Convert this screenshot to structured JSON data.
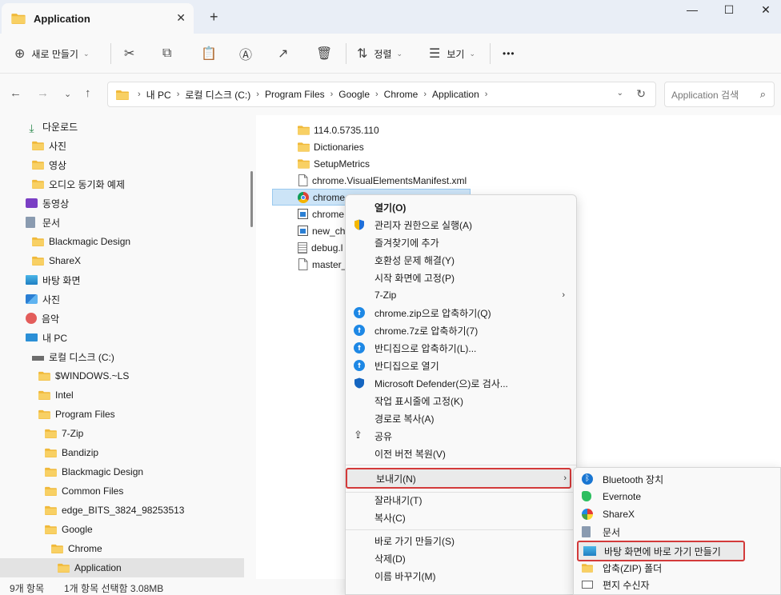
{
  "tab": {
    "title": "Application",
    "close": "✕",
    "new": "+"
  },
  "window": {
    "minimize": "—",
    "maximize": "☐",
    "close": "✕"
  },
  "toolbar": {
    "new_label": "새로 만들기",
    "sort_label": "정렬",
    "view_label": "보기",
    "more": "•••"
  },
  "address": {
    "crumbs": [
      "내 PC",
      "로컬 디스크 (C:)",
      "Program Files",
      "Google",
      "Chrome",
      "Application"
    ],
    "search_placeholder": "Application 검색"
  },
  "sidebar": {
    "items": [
      {
        "label": "다운로드",
        "icon": "download-icon"
      },
      {
        "label": "사진",
        "icon": "folder-icon"
      },
      {
        "label": "영상",
        "icon": "folder-icon"
      },
      {
        "label": "오디오 동기화 예제",
        "icon": "folder-icon"
      },
      {
        "label": "동영상",
        "icon": "video-icon"
      },
      {
        "label": "문서",
        "icon": "document-icon"
      },
      {
        "label": "Blackmagic Design",
        "icon": "folder-icon"
      },
      {
        "label": "ShareX",
        "icon": "folder-icon"
      },
      {
        "label": "바탕 화면",
        "icon": "desktop-icon"
      },
      {
        "label": "사진",
        "icon": "pictures-icon"
      },
      {
        "label": "음악",
        "icon": "music-icon"
      },
      {
        "label": "내 PC",
        "icon": "pc-icon"
      },
      {
        "label": "로컬 디스크 (C:)",
        "icon": "drive-icon"
      },
      {
        "label": "$WINDOWS.~LS",
        "icon": "folder-icon"
      },
      {
        "label": "Intel",
        "icon": "folder-icon"
      },
      {
        "label": "Program Files",
        "icon": "folder-icon"
      },
      {
        "label": "7-Zip",
        "icon": "folder-icon"
      },
      {
        "label": "Bandizip",
        "icon": "folder-icon"
      },
      {
        "label": "Blackmagic Design",
        "icon": "folder-icon"
      },
      {
        "label": "Common Files",
        "icon": "folder-icon"
      },
      {
        "label": "edge_BITS_3824_98253513",
        "icon": "folder-icon"
      },
      {
        "label": "Google",
        "icon": "folder-icon"
      },
      {
        "label": "Chrome",
        "icon": "folder-icon"
      },
      {
        "label": "Application",
        "icon": "folder-icon"
      }
    ]
  },
  "files": [
    {
      "name": "114.0.5735.110",
      "icon": "folder-icon"
    },
    {
      "name": "Dictionaries",
      "icon": "folder-icon"
    },
    {
      "name": "SetupMetrics",
      "icon": "folder-icon"
    },
    {
      "name": "chrome.VisualElementsManifest.xml",
      "icon": "file-icon"
    },
    {
      "name": "chrome",
      "icon": "chrome-icon"
    },
    {
      "name": "chrome",
      "icon": "app-icon"
    },
    {
      "name": "new_ch",
      "icon": "app-icon"
    },
    {
      "name": "debug.l",
      "icon": "log-icon"
    },
    {
      "name": "master_",
      "icon": "file-icon"
    }
  ],
  "context_menu": {
    "items": [
      {
        "label": "열기(O)",
        "icon": ""
      },
      {
        "label": "관리자 권한으로 실행(A)",
        "icon": "shield-icon"
      },
      {
        "label": "즐겨찾기에 추가",
        "icon": ""
      },
      {
        "label": "호환성 문제 해결(Y)",
        "icon": ""
      },
      {
        "label": "시작 화면에 고정(P)",
        "icon": ""
      },
      {
        "label": "7-Zip",
        "icon": ""
      },
      {
        "label": "chrome.zip으로 압축하기(Q)",
        "icon": "bandizip-icon"
      },
      {
        "label": "chrome.7z로 압축하기(7)",
        "icon": "bandizip-icon"
      },
      {
        "label": "반디집으로 압축하기(L)...",
        "icon": "bandizip-icon"
      },
      {
        "label": "반디집으로 열기",
        "icon": "bandizip-icon"
      },
      {
        "label": "Microsoft Defender(으)로 검사...",
        "icon": "defender-icon"
      },
      {
        "label": "작업 표시줄에 고정(K)",
        "icon": ""
      },
      {
        "label": "경로로 복사(A)",
        "icon": ""
      },
      {
        "label": "공유",
        "icon": "share-icon"
      },
      {
        "label": "이전 버전 복원(V)",
        "icon": ""
      },
      {
        "label": "보내기(N)",
        "icon": ""
      },
      {
        "label": "잘라내기(T)",
        "icon": ""
      },
      {
        "label": "복사(C)",
        "icon": ""
      },
      {
        "label": "바로 가기 만들기(S)",
        "icon": ""
      },
      {
        "label": "삭제(D)",
        "icon": ""
      },
      {
        "label": "이름 바꾸기(M)",
        "icon": ""
      }
    ]
  },
  "send_to_menu": {
    "items": [
      {
        "label": "Bluetooth 장치",
        "icon": "bluetooth-icon"
      },
      {
        "label": "Evernote",
        "icon": "evernote-icon"
      },
      {
        "label": "ShareX",
        "icon": "sharex-icon"
      },
      {
        "label": "문서",
        "icon": "document-icon"
      },
      {
        "label": "바탕 화면에 바로 가기 만들기",
        "icon": "desktop-icon"
      },
      {
        "label": "압축(ZIP) 폴더",
        "icon": "zip-folder-icon"
      },
      {
        "label": "편지 수신자",
        "icon": "mail-icon"
      }
    ]
  },
  "status": {
    "count": "9개 항목",
    "selection": "1개 항목 선택함 3.08MB"
  },
  "colors": {
    "folder": "#f3c44f",
    "selection": "#cce4f7",
    "highlight_border": "#d33a3a",
    "accent": "#0067c0"
  }
}
